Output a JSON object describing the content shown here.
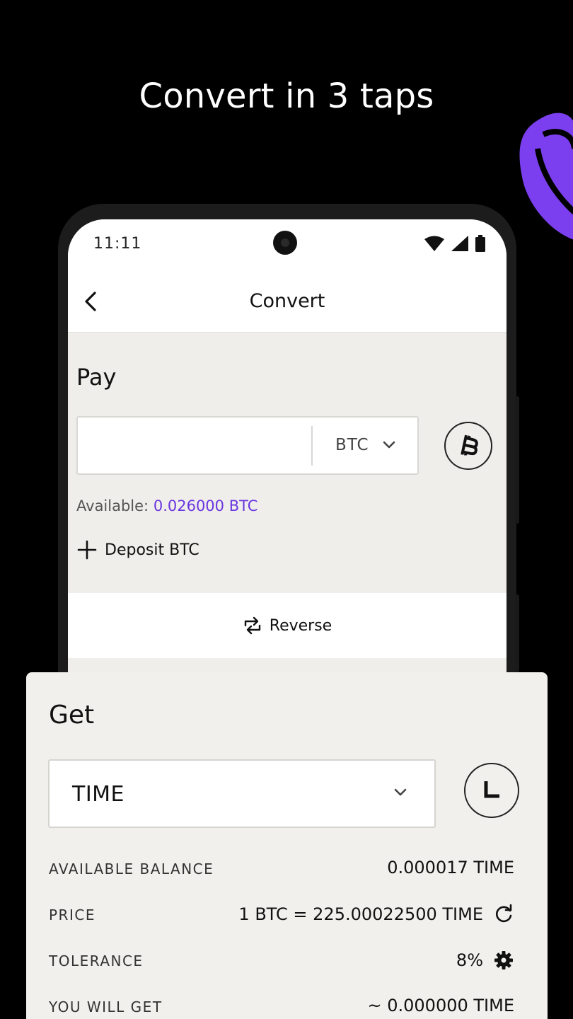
{
  "headline": "Convert in 3 taps",
  "status_bar": {
    "time": "11:11"
  },
  "app_bar": {
    "title": "Convert"
  },
  "pay": {
    "label": "Pay",
    "amount_placeholder": "",
    "currency": "BTC",
    "available_label": "Available:",
    "available_value": "0.026000 BTC",
    "deposit_label": "Deposit BTC"
  },
  "reverse_label": "Reverse",
  "get": {
    "label": "Get",
    "currency": "TIME",
    "rows": [
      {
        "key": "AVAILABLE BALANCE",
        "value": "0.000017 TIME"
      },
      {
        "key": "PRICE",
        "value": "1 BTC = 225.00022500 TIME"
      },
      {
        "key": "TOLERANCE",
        "value": "8%"
      },
      {
        "key": "YOU WILL GET",
        "value": "~ 0.000000 TIME"
      }
    ]
  },
  "colors": {
    "accent": "#6a35e0",
    "background": "#000000",
    "surface": "#efeeeb"
  }
}
